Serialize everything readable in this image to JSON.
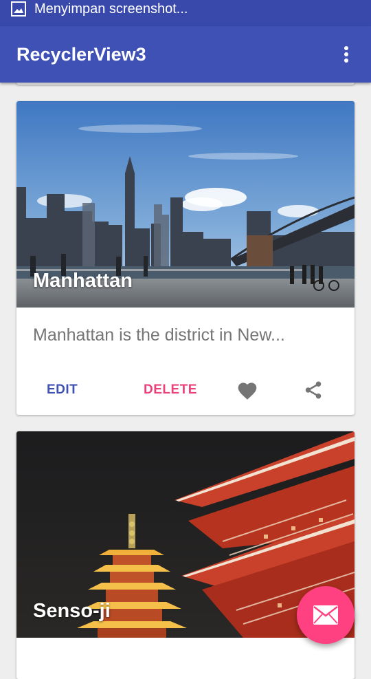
{
  "status_bar": {
    "notification_icon": "image-icon",
    "notification_text": "Menyimpan screenshot..."
  },
  "app_bar": {
    "title": "RecyclerView3",
    "overflow_icon": "more-vert-icon",
    "color": "#3f51b5"
  },
  "cards": [
    {
      "title": "Manhattan",
      "description": "Manhattan is the district in New...",
      "actions": {
        "edit_label": "EDIT",
        "delete_label": "DELETE",
        "favorite_icon": "heart-icon",
        "share_icon": "share-icon"
      }
    },
    {
      "title": "Senso-ji"
    }
  ],
  "fab": {
    "icon": "mail-icon",
    "color": "#ff4081"
  },
  "colors": {
    "primary": "#3f51b5",
    "primary_dark": "#3949ab",
    "accent": "#ff4081",
    "edit_text": "#3f51b5",
    "delete_text": "#ec407a"
  }
}
